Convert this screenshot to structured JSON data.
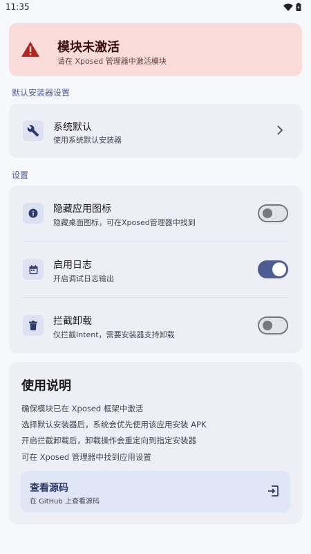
{
  "status_bar": {
    "time": "11:35"
  },
  "warning": {
    "title": "模块未激活",
    "subtitle": "请在 Xposed 管理器中激活模块",
    "color": "#f9dcd9"
  },
  "installer_section": {
    "label": "默认安装器设置",
    "item": {
      "title": "系统默认",
      "subtitle": "使用系统默认安装器",
      "icon": "wrench-icon"
    }
  },
  "settings_section": {
    "label": "设置",
    "items": [
      {
        "title": "隐藏应用图标",
        "subtitle": "隐藏桌面图标，可在Xposed管理器中找到",
        "icon": "info-icon",
        "enabled": false
      },
      {
        "title": "启用日志",
        "subtitle": "开启调试日志输出",
        "icon": "calendar-icon",
        "enabled": true
      },
      {
        "title": "拦截卸载",
        "subtitle": "仅拦截Intent，需要安装器支持卸载",
        "icon": "trash-icon",
        "enabled": false
      }
    ]
  },
  "help": {
    "title": "使用说明",
    "lines": [
      "确保模块已在 Xposed 框架中激活",
      "选择默认安装器后，系统会优先使用该应用安装 APK",
      "开启拦截卸载后，卸载操作会重定向到指定安装器",
      "可在 Xposed 管理器中找到应用设置"
    ],
    "source": {
      "title": "查看源码",
      "subtitle": "在 GitHub 上查看源码",
      "icon": "open-external-icon"
    }
  },
  "colors": {
    "accent": "#4d5c92",
    "background": "#f7f8fc",
    "card": "#eeeff6",
    "warning_icon": "#b3261e"
  }
}
